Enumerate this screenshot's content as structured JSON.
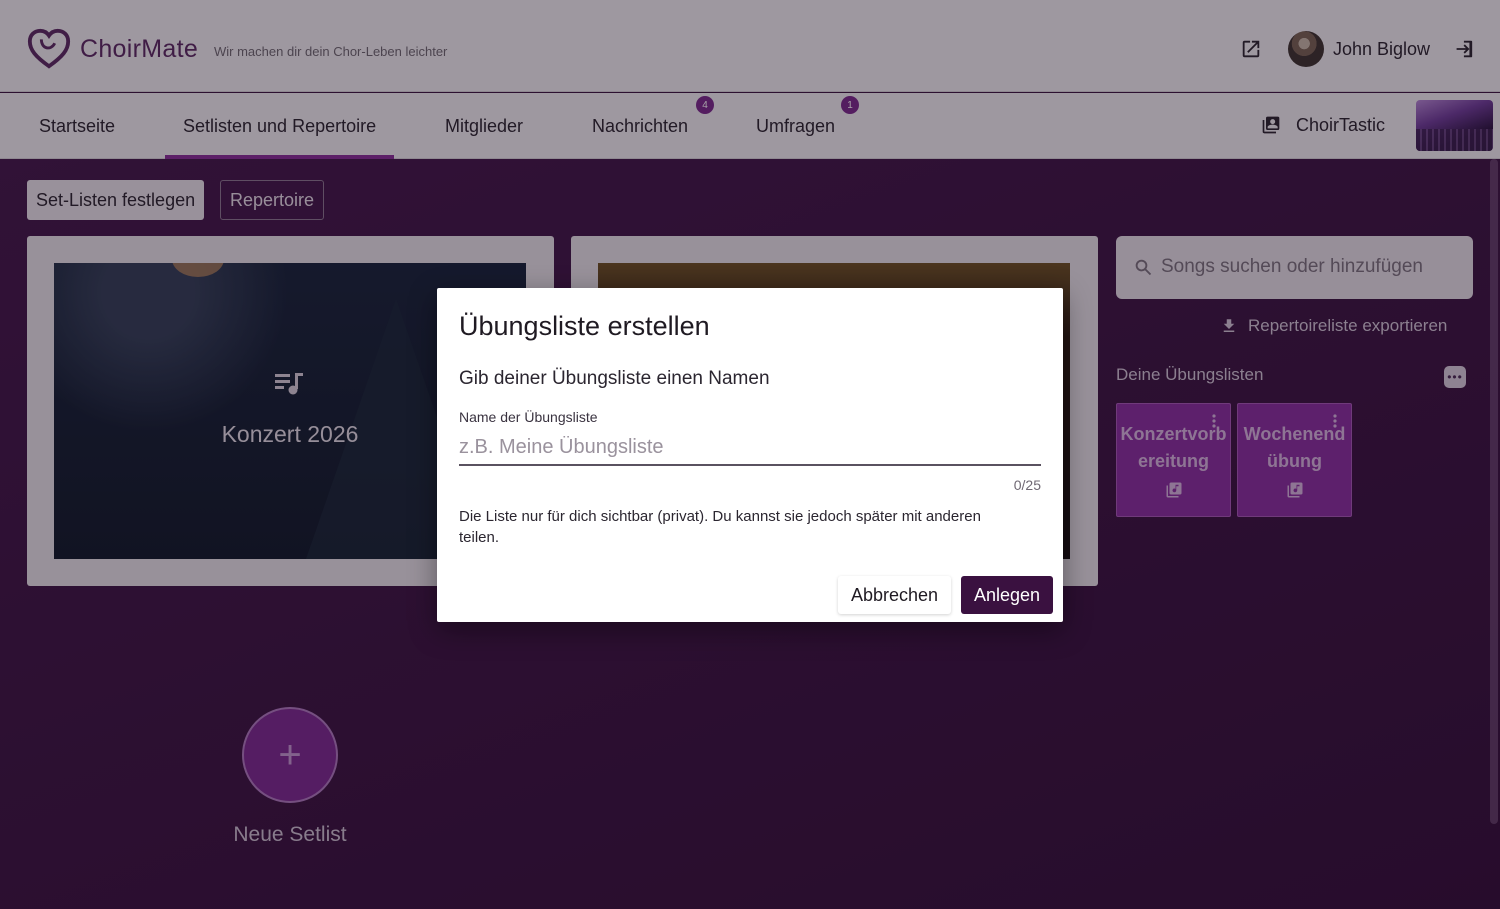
{
  "app": {
    "brand": "ChoirMate",
    "tagline": "Wir machen dir dein Chor-Leben leichter",
    "user_name": "John Biglow"
  },
  "nav": {
    "tabs": [
      {
        "label": "Startseite"
      },
      {
        "label": "Setlisten und Repertoire",
        "active": true
      },
      {
        "label": "Mitglieder"
      },
      {
        "label": "Nachrichten",
        "badge": "4"
      },
      {
        "label": "Umfragen",
        "badge": "1"
      }
    ],
    "choir_name": "ChoirTastic"
  },
  "toolbar": {
    "setlists_button": "Set-Listen festlegen",
    "repertoire_button": "Repertoire"
  },
  "setlists": {
    "cards": [
      {
        "title": "Konzert 2026"
      }
    ],
    "new_setlist_label": "Neue Setlist",
    "new_setlist_symbol": "+"
  },
  "sidebar": {
    "search_placeholder": "Songs suchen oder hinzufügen",
    "export_label": "Repertoireliste exportieren",
    "lists_title": "Deine Übungslisten",
    "more_symbol": "•••",
    "lists": [
      {
        "label": "Konzertvorbereitung"
      },
      {
        "label": "Wochenendübung"
      }
    ]
  },
  "dialog": {
    "title": "Übungsliste erstellen",
    "subtitle": "Gib deiner Übungsliste einen Namen",
    "field_label": "Name der Übungsliste",
    "field_value": "",
    "field_placeholder": "z.B. Meine Übungsliste",
    "counter": "0/25",
    "info": "Die Liste nur für dich sichtbar (privat). Du kannst sie jedoch später mit anderen teilen.",
    "cancel_label": "Abbrechen",
    "submit_label": "Anlegen"
  },
  "colors": {
    "accent": "#8a2f9a",
    "primary_button": "#3a1140",
    "background": "#3a1540",
    "tile": "#8a2fa0"
  },
  "icons": {
    "logo": "heart-logo-icon",
    "external": "open-external-icon",
    "logout": "logout-icon",
    "choir": "choir-library-icon",
    "search": "search-icon",
    "export": "download-icon",
    "playlist": "playlist-music-icon",
    "add": "plus-icon"
  }
}
